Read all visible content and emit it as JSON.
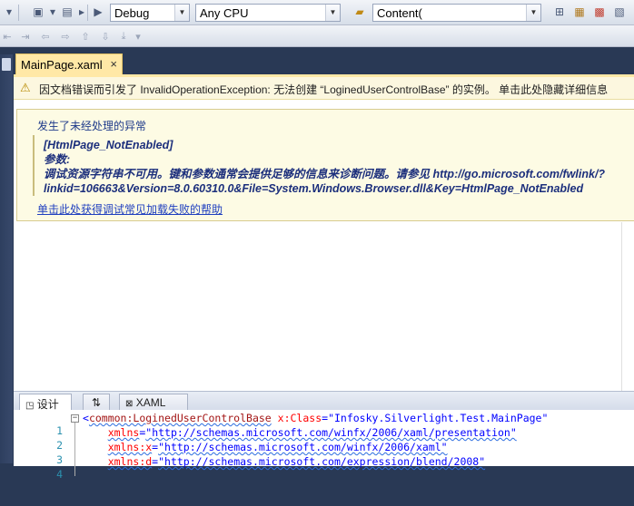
{
  "toolbar": {
    "configuration": "Debug",
    "platform": "Any CPU",
    "find_box": "Content("
  },
  "document": {
    "tab_label": "MainPage.xaml",
    "close_glyph": "×"
  },
  "infobar": {
    "message": "因文档错误而引发了 InvalidOperationException: 无法创建 “LoginedUserControlBase” 的实例。 单击此处隐藏详细信息"
  },
  "error": {
    "heading": "发生了未经处理的异常",
    "lines": [
      "[HtmlPage_NotEnabled]",
      "参数:",
      "调试资源字符串不可用。键和参数通常会提供足够的信息来诊断问题。请参见 http://go.microsoft.com/fwlink/?",
      "linkid=106663&Version=8.0.60310.0&File=System.Windows.Browser.dll&Key=HtmlPage_NotEnabled"
    ],
    "help_link": "单击此处获得调试常见加载失败的帮助"
  },
  "split_tabs": {
    "design": "设计",
    "swap": "⇅",
    "xaml": "XAML"
  },
  "code": {
    "lines": [
      {
        "n": "1",
        "prefix": "<",
        "tag": "common:LoginedUserControlBase",
        "attr": " x:Class",
        "eq": "=",
        "val": "\"Infosky.Silverlight.Test.MainPage\""
      },
      {
        "n": "2",
        "prefix": "    ",
        "tag": "",
        "attr": "xmlns",
        "eq": "=",
        "val": "\"http://schemas.microsoft.com/winfx/2006/xaml/presentation\""
      },
      {
        "n": "3",
        "prefix": "    ",
        "tag": "",
        "attr": "xmlns:x",
        "eq": "=",
        "val": "\"http://schemas.microsoft.com/winfx/2006/xaml\""
      },
      {
        "n": "4",
        "prefix": "    ",
        "tag": "",
        "attr": "xmlns:d",
        "eq": "=",
        "val": "\"http://schemas.microsoft.com/expression/blend/2008\""
      }
    ]
  },
  "colors": {
    "accent_tab": "#ffe8a6",
    "background": "#293955",
    "info_background": "#fdfbe4"
  }
}
